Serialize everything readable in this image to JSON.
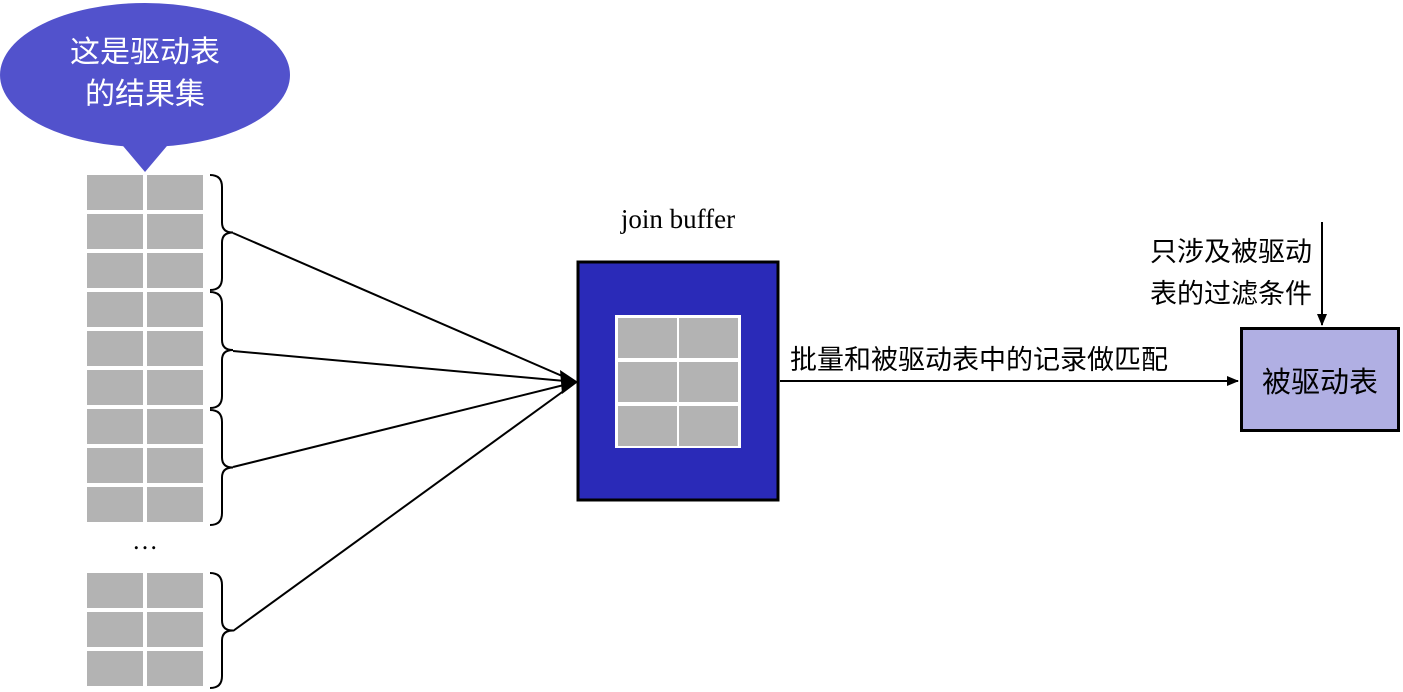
{
  "bubble": {
    "line1": "这是驱动表",
    "line2": "的结果集",
    "color": "#5252cc"
  },
  "driving_table": {
    "ellipsis": "…",
    "cell_color": "#b3b3b3"
  },
  "join_buffer": {
    "label": "join buffer",
    "color": "#2a2ab8",
    "cell_color": "#b3b3b3"
  },
  "match_label": "批量和被驱动表中的记录做匹配",
  "filter_label": {
    "line1": "只涉及被驱动",
    "line2": "表的过滤条件"
  },
  "driven_table": {
    "label": "被驱动表",
    "color": "#b0afe3"
  }
}
